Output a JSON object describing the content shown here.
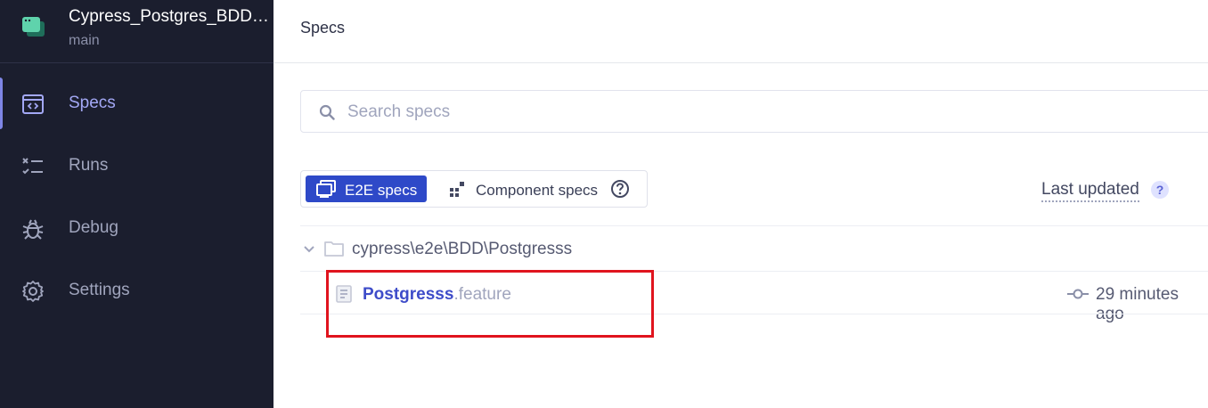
{
  "sidebar": {
    "project_title": "Cypress_Postgres_BDD_Framework",
    "branch": "main",
    "items": [
      {
        "label": "Specs",
        "icon": "specs-icon",
        "active": true
      },
      {
        "label": "Runs",
        "icon": "runs-icon",
        "active": false
      },
      {
        "label": "Debug",
        "icon": "bug-icon",
        "active": false
      },
      {
        "label": "Settings",
        "icon": "gear-icon",
        "active": false
      }
    ]
  },
  "header": {
    "title": "Specs"
  },
  "search": {
    "placeholder": "Search specs",
    "value": ""
  },
  "spec_type_toggle": {
    "e2e_label": "E2E specs",
    "component_label": "Component specs",
    "selected": "E2E specs"
  },
  "column_header": {
    "last_updated": "Last updated",
    "help_icon": "?"
  },
  "folder": {
    "path": "cypress\\e2e\\BDD\\Postgresss"
  },
  "spec": {
    "base_name": "Postgresss",
    "extension": ".feature",
    "updated": "29 minutes ago"
  },
  "colors": {
    "sidebar_bg": "#1b1e2e",
    "accent": "#2e49c8",
    "spec_link": "#3e4cc9",
    "highlight": "#e0141e"
  }
}
